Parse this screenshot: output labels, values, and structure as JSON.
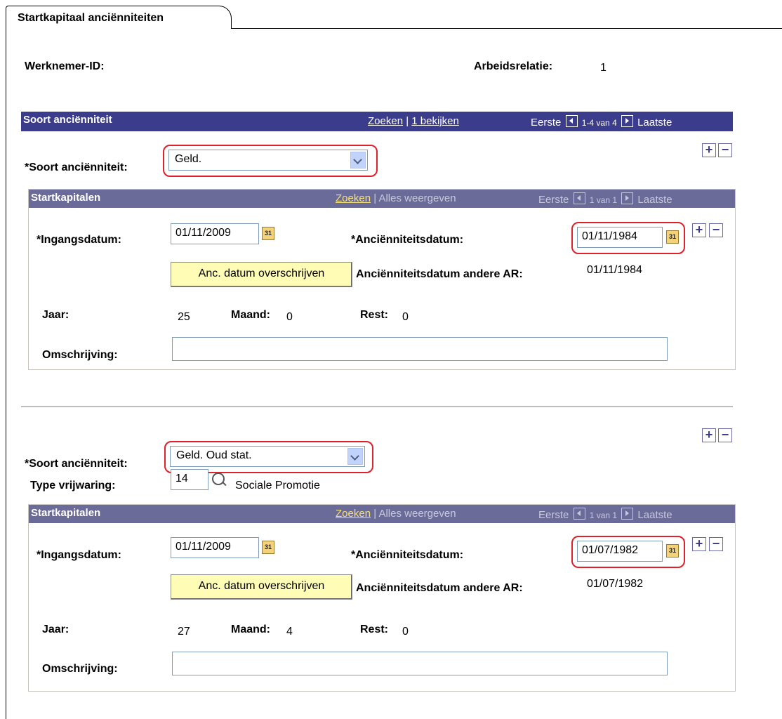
{
  "tab": {
    "label": "Startkapitaal anciënniteiten"
  },
  "header": {
    "werknemer_id_label": "Werknemer-ID:",
    "arbeidsrelatie_label": "Arbeidsrelatie:",
    "arbeidsrelatie_value": "1"
  },
  "level1": {
    "title": "Soort anciënniteit",
    "zoeken": "Zoeken",
    "sep": "|",
    "view": "1 bekijken",
    "first": "Eerste",
    "range": "1-4 van 4",
    "last": "Laatste"
  },
  "records": [
    {
      "soort_label": "*Soort anciënniteit:",
      "soort_value": "Geld.",
      "sub": {
        "title": "Startkapitalen",
        "zoeken": "Zoeken",
        "sep": "|",
        "show_all": "Alles weergeven",
        "first": "Eerste",
        "range": "1 van 1",
        "last": "Laatste"
      },
      "ingangsdatum_label": "*Ingangsdatum:",
      "ingangsdatum_value": "01/11/2009",
      "anc_label": "*Anciënniteitsdatum:",
      "anc_value": "01/11/1984",
      "button": "Anc. datum overschrijven",
      "andere_label": "Anciënniteitsdatum andere AR:",
      "andere_value": "01/11/1984",
      "jaar_label": "Jaar:",
      "jaar_value": "25",
      "maand_label": "Maand:",
      "maand_value": "0",
      "rest_label": "Rest:",
      "rest_value": "0",
      "omschrijving_label": "Omschrijving:",
      "omschrijving_value": ""
    },
    {
      "soort_label": "*Soort anciënniteit:",
      "soort_value": "Geld. Oud stat.",
      "type_label": "Type vrijwaring:",
      "type_value": "14",
      "type_desc": "Sociale Promotie",
      "sub": {
        "title": "Startkapitalen",
        "zoeken": "Zoeken",
        "sep": "|",
        "show_all": "Alles weergeven",
        "first": "Eerste",
        "range": "1 van 1",
        "last": "Laatste"
      },
      "ingangsdatum_label": "*Ingangsdatum:",
      "ingangsdatum_value": "01/11/2009",
      "anc_label": "*Anciënniteitsdatum:",
      "anc_value": "01/07/1982",
      "button": "Anc. datum overschrijven",
      "andere_label": "Anciënniteitsdatum andere AR:",
      "andere_value": "01/07/1982",
      "jaar_label": "Jaar:",
      "jaar_value": "27",
      "maand_label": "Maand:",
      "maand_value": "4",
      "rest_label": "Rest:",
      "rest_value": "0",
      "omschrijving_label": "Omschrijving:",
      "omschrijving_value": ""
    }
  ],
  "icons": {
    "calendar": "calendar-icon",
    "add": "plus-icon",
    "delete": "minus-icon",
    "lookup": "magnifier-icon",
    "calendar_text": "31",
    "plus_text": "+",
    "minus_text": "−"
  },
  "colors": {
    "grid_header": "#3c3c8c",
    "sub_header": "#6b6b99",
    "highlight": "#e0202a",
    "button_bg": "#fffcb5"
  }
}
